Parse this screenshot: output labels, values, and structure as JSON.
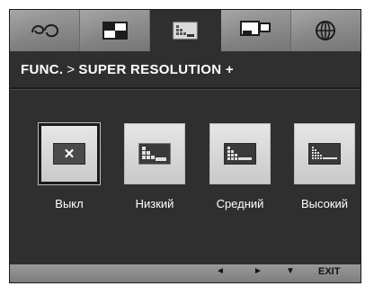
{
  "title": {
    "prefix": "FUNC.",
    "separator": ">",
    "section": "SUPER RESOLUTION +"
  },
  "tabs": [
    {
      "icon": "eco-icon",
      "active": false
    },
    {
      "icon": "picture-mode-icon",
      "active": false
    },
    {
      "icon": "super-resolution-icon",
      "active": true
    },
    {
      "icon": "dual-screen-icon",
      "active": false
    },
    {
      "icon": "language-globe-icon",
      "active": false
    }
  ],
  "options": [
    {
      "label": "Выкл",
      "icon": "off-x-icon",
      "selected": true
    },
    {
      "label": "Низкий",
      "icon": "low-level-icon",
      "selected": false
    },
    {
      "label": "Средний",
      "icon": "medium-level-icon",
      "selected": false
    },
    {
      "label": "Высокий",
      "icon": "high-level-icon",
      "selected": false
    }
  ],
  "footer": {
    "left_arrow": "◄",
    "right_arrow": "►",
    "down_arrow": "▼",
    "exit_label": "EXIT"
  },
  "colors": {
    "osd_background": "#2f2f2f",
    "tab_strip": "#8c8c8c",
    "button_face": "#d8d8d8",
    "text": "#ffffff"
  }
}
